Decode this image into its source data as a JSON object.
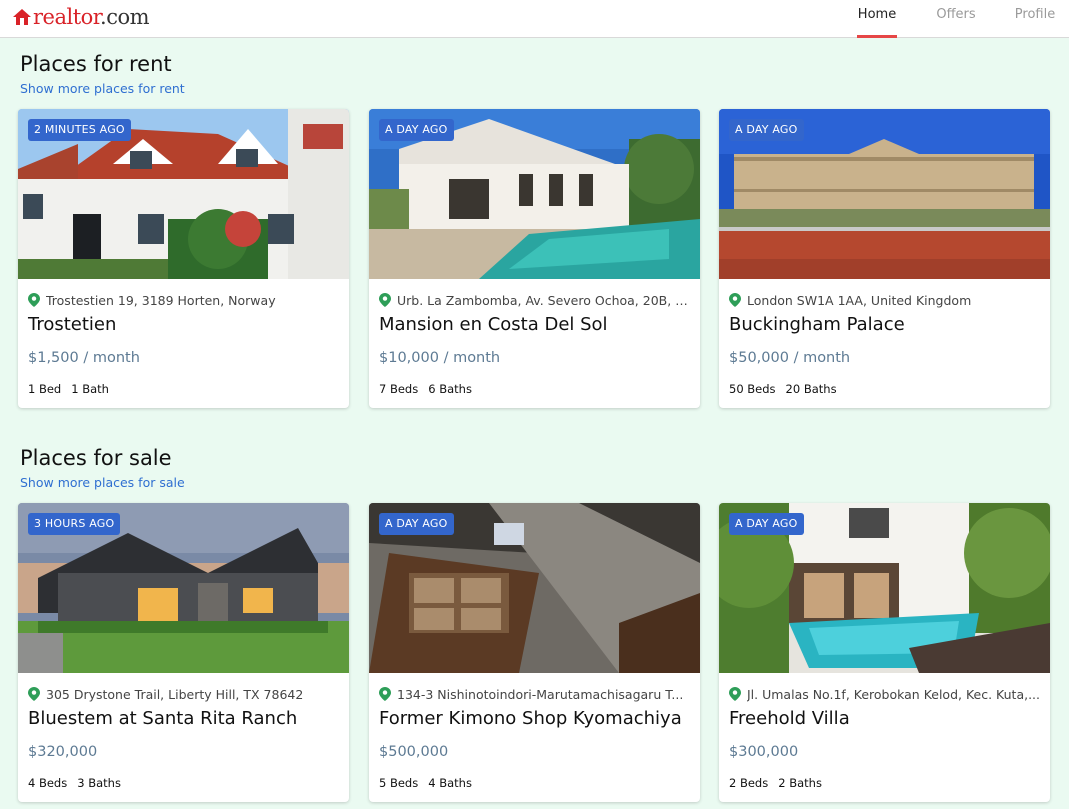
{
  "header": {
    "logo_text_main": "realtor",
    "logo_text_suffix": ".com",
    "nav": [
      {
        "label": "Home",
        "active": true
      },
      {
        "label": "Offers",
        "active": false
      },
      {
        "label": "Profile",
        "active": false
      }
    ]
  },
  "rent": {
    "title": "Places for rent",
    "link": "Show more places for rent",
    "cards": [
      {
        "badge": "2 MINUTES AGO",
        "address": "Trostestien 19, 3189 Horten, Norway",
        "name": "Trostetien",
        "price": "$1,500 / month",
        "beds": "1 Bed",
        "baths": "1 Bath"
      },
      {
        "badge": "A DAY AGO",
        "address": "Urb. La Zambomba, Av. Severo Ochoa, 20B, 2...",
        "name": "Mansion en Costa Del Sol",
        "price": "$10,000 / month",
        "beds": "7 Beds",
        "baths": "6 Baths"
      },
      {
        "badge": "A DAY AGO",
        "address": "London SW1A 1AA, United Kingdom",
        "name": "Buckingham Palace",
        "price": "$50,000 / month",
        "beds": "50 Beds",
        "baths": "20 Baths"
      }
    ]
  },
  "sale": {
    "title": "Places for sale",
    "link": "Show more places for sale",
    "cards": [
      {
        "badge": "3 HOURS AGO",
        "address": "305 Drystone Trail, Liberty Hill, TX 78642",
        "name": "Bluestem at Santa Rita Ranch",
        "price": "$320,000",
        "beds": "4 Beds",
        "baths": "3 Baths"
      },
      {
        "badge": "A DAY AGO",
        "address": "134-3 Nishinotoindori-Marutamachisagaru T...",
        "name": "Former Kimono Shop Kyomachiya",
        "price": "$500,000",
        "beds": "5 Beds",
        "baths": "4 Baths"
      },
      {
        "badge": "A DAY AGO",
        "address": "Jl. Umalas No.1f, Kerobokan Kelod, Kec. Kuta,...",
        "name": "Freehold Villa",
        "price": "$300,000",
        "beds": "2 Beds",
        "baths": "2 Baths"
      }
    ]
  },
  "colors": {
    "brand": "#d92228",
    "background": "#eafaf1",
    "badge": "#3366cc",
    "link": "#2f6fd1",
    "price": "#5d7a93",
    "pin": "#2e9e58",
    "active_underline": "#e64646"
  },
  "icons": {
    "logo": "house-logo-icon",
    "address": "map-pin-icon"
  }
}
